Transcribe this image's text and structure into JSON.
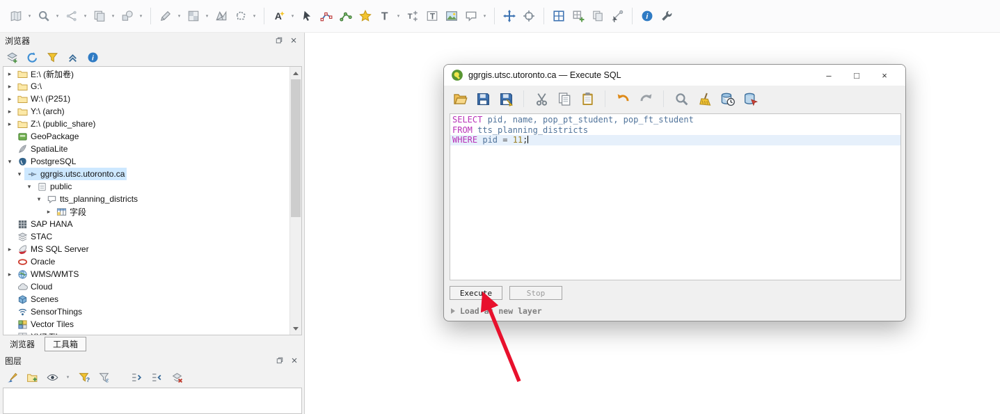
{
  "annotation": {
    "color": "#e8112d"
  },
  "syntax_colors": {
    "keyword": "#b832b8",
    "identifier": "#51749b",
    "number": "#9a7d1e",
    "operator": "#444444",
    "terminator": "#333333"
  },
  "selection_color": "#cde8ff",
  "top_toolbar": {
    "items": [
      {
        "name": "folded-map-icon",
        "glyph": "map",
        "dropdown": true
      },
      {
        "name": "map-magnifier-icon",
        "glyph": "magnifier",
        "dropdown": true
      },
      {
        "name": "share-nodes-icon",
        "glyph": "share",
        "dropdown": true
      },
      {
        "name": "duplicate-sheets-icon",
        "glyph": "copysheets",
        "dropdown": true
      },
      {
        "name": "geometry-shapes-icon",
        "glyph": "shapes",
        "dropdown": true
      },
      {
        "sep": true
      },
      {
        "name": "pencil-edit-icon",
        "glyph": "pen",
        "dropdown": true
      },
      {
        "name": "raster-checker-icon",
        "glyph": "raster",
        "dropdown": true
      },
      {
        "name": "mesh-triangles-icon",
        "glyph": "mesh"
      },
      {
        "name": "dashed-polygon-icon",
        "glyph": "dashpoly",
        "dropdown": true
      },
      {
        "sep": true
      },
      {
        "name": "auto-label-icon",
        "glyph": "labelA",
        "dropdown": true
      },
      {
        "name": "pointer-select-icon",
        "glyph": "pointer"
      },
      {
        "name": "digitize-line-icon",
        "glyph": "bluenodes"
      },
      {
        "name": "vertex-tool-icon",
        "glyph": "greennodes"
      },
      {
        "name": "favorites-star-icon",
        "glyph": "star"
      },
      {
        "name": "text-annotation-icon",
        "glyph": "textT",
        "dropdown": true
      },
      {
        "name": "move-annotation-icon",
        "glyph": "movelabel"
      },
      {
        "name": "form-annotation-icon",
        "glyph": "framedT"
      },
      {
        "name": "image-annotation-icon",
        "glyph": "picture"
      },
      {
        "name": "html-annotation-icon",
        "glyph": "bubble",
        "dropdown": true
      },
      {
        "sep": true
      },
      {
        "name": "pan-arrows-icon",
        "glyph": "bluemove"
      },
      {
        "name": "crosshair-icon",
        "glyph": "crosshair"
      },
      {
        "sep": true
      },
      {
        "name": "grid-extent-icon",
        "glyph": "bluegrid"
      },
      {
        "name": "new-grid-icon",
        "glyph": "gridplus"
      },
      {
        "name": "copy-style-icon",
        "glyph": "copysheets2"
      },
      {
        "name": "line-select-icon",
        "glyph": "cursorline"
      },
      {
        "sep": true
      },
      {
        "name": "help-info-icon",
        "glyph": "info"
      },
      {
        "name": "settings-wrench-icon",
        "glyph": "wrench"
      }
    ]
  },
  "browser_panel": {
    "title": "浏览器",
    "toolbar": [
      {
        "name": "add-selected-layers-icon",
        "glyph": "layerplus"
      },
      {
        "name": "refresh-icon",
        "glyph": "refresh"
      },
      {
        "name": "filter-browser-icon",
        "glyph": "funnel"
      },
      {
        "name": "collapse-all-icon",
        "glyph": "collapseup"
      },
      {
        "name": "properties-widget-icon",
        "glyph": "info"
      }
    ],
    "tree": [
      {
        "id": "drive-e",
        "label": "E:\\ (新加卷)",
        "level": 0,
        "icon": "folder",
        "exp": "collapsed"
      },
      {
        "id": "drive-g",
        "label": "G:\\",
        "level": 0,
        "icon": "folder",
        "exp": "collapsed"
      },
      {
        "id": "drive-w",
        "label": "W:\\ (P251)",
        "level": 0,
        "icon": "folder",
        "exp": "collapsed"
      },
      {
        "id": "drive-y",
        "label": "Y:\\ (arch)",
        "level": 0,
        "icon": "folder",
        "exp": "collapsed"
      },
      {
        "id": "drive-z",
        "label": "Z:\\ (public_share)",
        "level": 0,
        "icon": "folder",
        "exp": "collapsed"
      },
      {
        "id": "geopackage",
        "label": "GeoPackage",
        "level": 0,
        "icon": "geopackage",
        "exp": "none"
      },
      {
        "id": "spatialite",
        "label": "SpatiaLite",
        "level": 0,
        "icon": "spatialite",
        "exp": "none"
      },
      {
        "id": "postgresql",
        "label": "PostgreSQL",
        "level": 0,
        "icon": "postgresql",
        "exp": "expanded"
      },
      {
        "id": "connection-ggrgis",
        "label": "ggrgis.utsc.utoronto.ca",
        "level": 1,
        "icon": "connection",
        "exp": "expanded",
        "selected": true
      },
      {
        "id": "schema-public",
        "label": "public",
        "level": 2,
        "icon": "schema",
        "exp": "expanded"
      },
      {
        "id": "table-tts-planning-districts",
        "label": "tts_planning_districts",
        "level": 3,
        "icon": "layerbubble",
        "exp": "expanded"
      },
      {
        "id": "fields",
        "label": "字段",
        "level": 4,
        "icon": "fields",
        "exp": "collapsed"
      },
      {
        "id": "sap-hana",
        "label": "SAP HANA",
        "level": 0,
        "icon": "saphana",
        "exp": "none"
      },
      {
        "id": "stac",
        "label": "STAC",
        "level": 0,
        "icon": "stac",
        "exp": "none"
      },
      {
        "id": "ms-sql-server",
        "label": "MS SQL Server",
        "level": 0,
        "icon": "mssql",
        "exp": "collapsed"
      },
      {
        "id": "oracle",
        "label": "Oracle",
        "level": 0,
        "icon": "oracle",
        "exp": "none"
      },
      {
        "id": "wms-wmts",
        "label": "WMS/WMTS",
        "level": 0,
        "icon": "wms",
        "exp": "collapsed"
      },
      {
        "id": "cloud",
        "label": "Cloud",
        "level": 0,
        "icon": "cloud",
        "exp": "none"
      },
      {
        "id": "scenes",
        "label": "Scenes",
        "level": 0,
        "icon": "scenes",
        "exp": "none"
      },
      {
        "id": "sensorthings",
        "label": "SensorThings",
        "level": 0,
        "icon": "sensorthings",
        "exp": "none"
      },
      {
        "id": "vector-tiles",
        "label": "Vector Tiles",
        "level": 0,
        "icon": "vectortiles",
        "exp": "none"
      },
      {
        "id": "xyz-tiles",
        "label": "XYZ Tiles",
        "level": 0,
        "icon": "xyz",
        "exp": "collapsed"
      }
    ]
  },
  "dock_tabs": [
    {
      "label": "浏览器",
      "active": true
    },
    {
      "label": "工具箱",
      "active": false
    }
  ],
  "layers_panel": {
    "title": "图层",
    "toolbar": [
      {
        "name": "open-layer-styling-icon",
        "glyph": "brush"
      },
      {
        "name": "add-group-icon",
        "glyph": "folderplus"
      },
      {
        "name": "manage-map-themes-icon",
        "glyph": "eye",
        "dropdown": true
      },
      {
        "name": "filter-legend-icon",
        "glyph": "funnelq"
      },
      {
        "name": "filter-by-expression-icon",
        "glyph": "funnelexp"
      },
      {
        "gap": true
      },
      {
        "name": "expand-all-icon",
        "glyph": "expandtree"
      },
      {
        "name": "collapse-all-icon",
        "glyph": "collapsetree"
      },
      {
        "name": "remove-layer-icon",
        "glyph": "removelayer"
      }
    ]
  },
  "dialog": {
    "title": "ggrgis.utsc.utoronto.ca — Execute SQL",
    "controls": {
      "minimize": "–",
      "maximize": "□",
      "close": "×"
    },
    "toolbar": [
      {
        "name": "open-file-icon",
        "glyph": "folderopen"
      },
      {
        "name": "save-icon",
        "glyph": "floppy"
      },
      {
        "name": "save-as-icon",
        "glyph": "floppypencil"
      },
      {
        "sep": true
      },
      {
        "name": "cut-icon",
        "glyph": "scissors"
      },
      {
        "name": "copy-icon",
        "glyph": "copydoc"
      },
      {
        "name": "paste-icon",
        "glyph": "clipboard"
      },
      {
        "sep": true
      },
      {
        "name": "undo-icon",
        "glyph": "undo"
      },
      {
        "name": "redo-icon",
        "glyph": "redo"
      },
      {
        "sep": true
      },
      {
        "name": "find-icon",
        "glyph": "magnifier"
      },
      {
        "name": "clear-icon",
        "glyph": "broom"
      },
      {
        "name": "query-history-icon",
        "glyph": "dbclock"
      },
      {
        "name": "execute-query-icon",
        "glyph": "dbrun"
      }
    ],
    "sql": {
      "lines": [
        {
          "tokens": [
            {
              "t": "SELECT",
              "k": "kw"
            },
            {
              "t": " pid, name, pop_pt_student, pop_ft_student",
              "k": "id"
            }
          ]
        },
        {
          "tokens": [
            {
              "t": "FROM",
              "k": "kw"
            },
            {
              "t": " tts_planning_districts",
              "k": "id"
            }
          ]
        },
        {
          "tokens": [
            {
              "t": "WHERE",
              "k": "kw"
            },
            {
              "t": " pid ",
              "k": "id"
            },
            {
              "t": "= ",
              "k": "op"
            },
            {
              "t": "11",
              "k": "num"
            },
            {
              "t": ";",
              "k": "end"
            }
          ],
          "current": true,
          "caret": true
        }
      ]
    },
    "execute_label": "Execute",
    "stop_label": "Stop",
    "load_label": "Load as new layer"
  }
}
